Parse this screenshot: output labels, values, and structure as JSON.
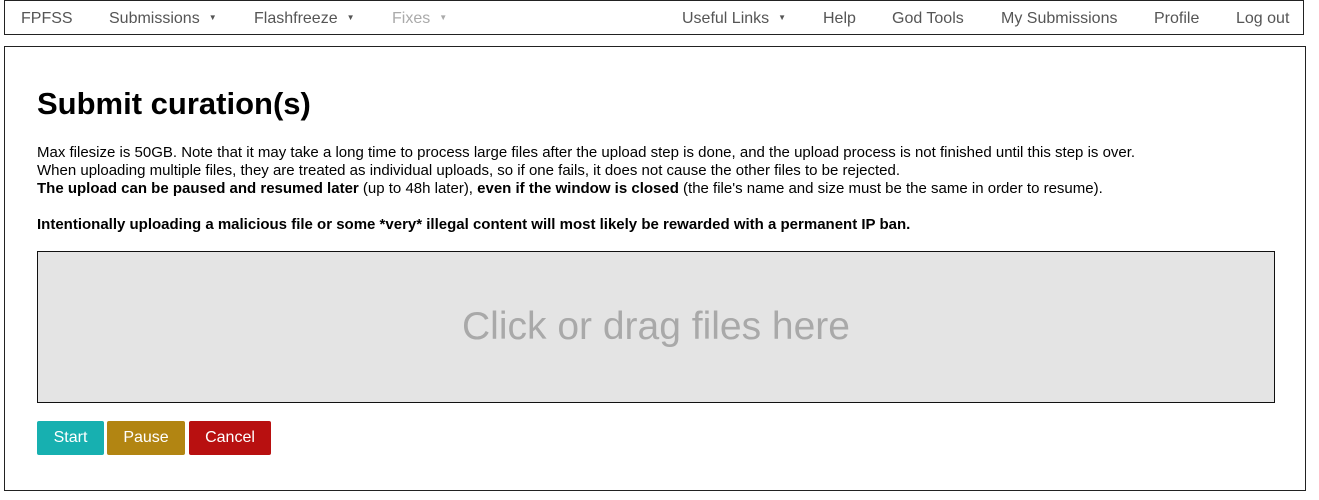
{
  "navbar": {
    "brand": "FPFSS",
    "items": [
      {
        "label": "Submissions",
        "dropdown": true,
        "disabled": false
      },
      {
        "label": "Flashfreeze",
        "dropdown": true,
        "disabled": false
      },
      {
        "label": "Fixes",
        "dropdown": true,
        "disabled": true
      }
    ],
    "right_items": [
      {
        "label": "Useful Links",
        "dropdown": true
      },
      {
        "label": "Help"
      },
      {
        "label": "God Tools"
      },
      {
        "label": "My Submissions"
      },
      {
        "label": "Profile"
      },
      {
        "label": "Log out"
      }
    ],
    "caret_glyph": "▼"
  },
  "main": {
    "title": "Submit curation(s)",
    "info": {
      "line1": "Max filesize is 50GB. Note that it may take a long time to process large files after the upload step is done, and the upload process is not finished until this step is over.",
      "line2": "When uploading multiple files, they are treated as individual uploads, so if one fails, it does not cause the other files to be rejected.",
      "line3_bold_a": "The upload can be paused and resumed later",
      "line3_text_a": " (up to 48h later), ",
      "line3_bold_b": "even if the window is closed",
      "line3_text_b": " (the file's name and size must be the same in order to resume)."
    },
    "warning": "Intentionally uploading a malicious file or some *very* illegal content will most likely be rewarded with a permanent IP ban.",
    "dropzone_text": "Click or drag files here",
    "buttons": {
      "start": "Start",
      "pause": "Pause",
      "cancel": "Cancel"
    }
  },
  "colors": {
    "start": "#17b0b0",
    "pause": "#b28512",
    "cancel": "#b81010",
    "dropzone_bg": "#e4e4e4"
  }
}
